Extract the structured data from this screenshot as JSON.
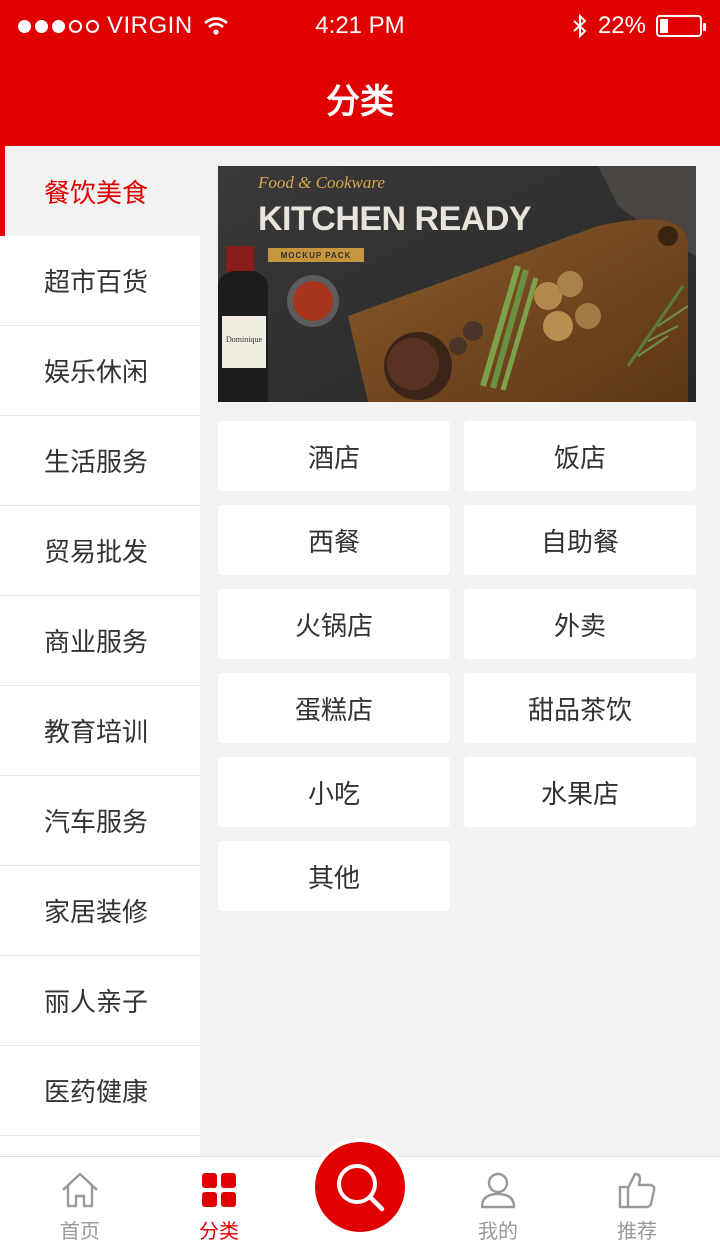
{
  "status_bar": {
    "carrier": "VIRGIN",
    "time": "4:21 PM",
    "battery": "22%",
    "battery_level": 0.22,
    "signal_bars_filled": 3,
    "signal_bars_total": 5
  },
  "header": {
    "title": "分类"
  },
  "colors": {
    "brand": "#e00000",
    "background": "#f2f2f2",
    "text": "#333333",
    "inactive": "#999999"
  },
  "sidebar": {
    "active_index": 0,
    "items": [
      {
        "label": "餐饮美食"
      },
      {
        "label": "超市百货"
      },
      {
        "label": "娱乐休闲"
      },
      {
        "label": "生活服务"
      },
      {
        "label": "贸易批发"
      },
      {
        "label": "商业服务"
      },
      {
        "label": "教育培训"
      },
      {
        "label": "汽车服务"
      },
      {
        "label": "家居装修"
      },
      {
        "label": "丽人亲子"
      },
      {
        "label": "医药健康"
      }
    ]
  },
  "banner": {
    "script_line": "Food & Cookware",
    "headline": "KITCHEN READY",
    "ribbon": "MOCKUP PACK",
    "bottle_label": "Dominique"
  },
  "subcategories": [
    {
      "label": "酒店"
    },
    {
      "label": "饭店"
    },
    {
      "label": "西餐"
    },
    {
      "label": "自助餐"
    },
    {
      "label": "火锅店"
    },
    {
      "label": "外卖"
    },
    {
      "label": "蛋糕店"
    },
    {
      "label": "甜品茶饮"
    },
    {
      "label": "小吃"
    },
    {
      "label": "水果店"
    },
    {
      "label": "其他"
    }
  ],
  "tabbar": {
    "active_index": 1,
    "tabs": [
      {
        "label": "首页",
        "icon": "home-icon"
      },
      {
        "label": "分类",
        "icon": "grid-icon"
      },
      {
        "label": "我的",
        "icon": "user-icon"
      },
      {
        "label": "推荐",
        "icon": "thumbs-up-icon"
      }
    ],
    "center_icon": "search-icon"
  }
}
